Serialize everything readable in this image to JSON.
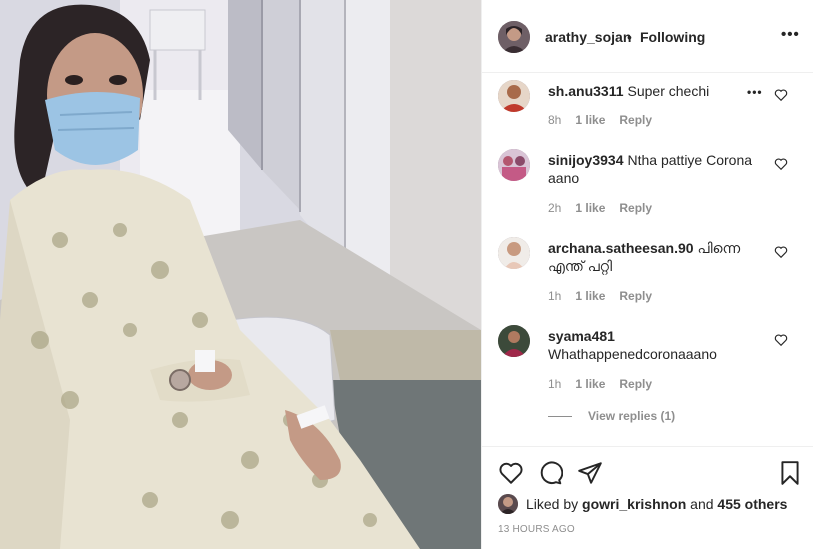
{
  "post": {
    "username": "arathy_sojan",
    "separator": "•",
    "follow_status": "Following",
    "more_label": "•••"
  },
  "comments": [
    {
      "username": "sh.anu3311",
      "text": "Super chechi",
      "time": "8h",
      "likes": "1 like",
      "reply": "Reply",
      "options": "•••"
    },
    {
      "username": "sinijoy3934",
      "text": "Ntha pattiye Corona aano",
      "time": "2h",
      "likes": "1 like",
      "reply": "Reply"
    },
    {
      "username": "archana.satheesan.90",
      "text": "പിന്നെ എന്ത് പറ്റി",
      "time": "1h",
      "likes": "1 like",
      "reply": "Reply"
    },
    {
      "username": "syama481",
      "text": "Whathappenedcoronaaano",
      "time": "1h",
      "likes": "1 like",
      "reply": "Reply"
    }
  ],
  "view_replies": "View replies (1)",
  "likes": {
    "prefix": "Liked by",
    "user": "gowri_krishnon",
    "joiner": "and",
    "others": "455 others"
  },
  "timestamp": "13 HOURS AGO",
  "icons": {
    "like": "heart-icon",
    "comment": "comment-icon",
    "share": "share-icon",
    "save": "bookmark-icon"
  },
  "colors": {
    "text": "#262626",
    "secondary": "#8e8e8e",
    "divider": "#efefef"
  }
}
